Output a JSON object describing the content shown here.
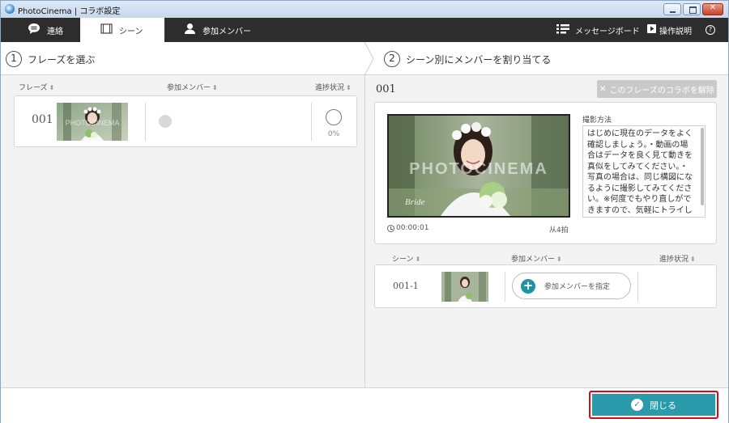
{
  "window": {
    "title": "PhotoCinema | コラボ設定"
  },
  "nav": {
    "tabs": [
      {
        "label": "連絡"
      },
      {
        "label": "シーン"
      },
      {
        "label": "参加メンバー"
      }
    ],
    "message_board": "メッセージボード",
    "help": "操作説明",
    "help_icon": "?"
  },
  "steps": {
    "step1": {
      "num": "1",
      "label": "フレーズを選ぶ"
    },
    "step2": {
      "num": "2",
      "label": "シーン別にメンバーを割り当てる"
    }
  },
  "left": {
    "headers": {
      "phrase": "フレーズ",
      "member": "参加メンバー",
      "progress": "進捗状況"
    },
    "phrase": {
      "num": "001",
      "progress": "0%"
    }
  },
  "right": {
    "title": "001",
    "unlink_button": "このフレーズのコラボを解除",
    "video": {
      "timecode": "00:00:01",
      "shots": "从4拍",
      "watermark": "PHOTOCINEMA",
      "script_text": "Bride"
    },
    "method": {
      "label": "撮影方法",
      "text": "はじめに現在のデータをよく確認しましょう。・動画の場合はデータを良く見て動きを真似をしてみてください。・写真の場合は、同じ構図になるように撮影してみてください。※何度でもやり直しができますので、気軽にトライしてみてください。"
    },
    "headers": {
      "scene": "シーン",
      "member": "参加メンバー",
      "progress": "進捗状況"
    },
    "scene": {
      "num": "001-1",
      "assign_label": "参加メンバーを指定"
    }
  },
  "footer": {
    "close_label": "閉じる"
  },
  "sort_glyph": "⬍",
  "colors": {
    "accent": "#2b9aaa",
    "highlight": "#c8101c",
    "navbar": "#2d2d2d"
  }
}
